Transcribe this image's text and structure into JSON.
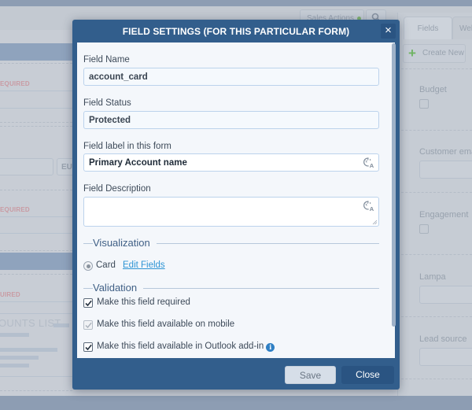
{
  "background": {
    "header": {
      "sales_actions_label": "Sales Actions",
      "search_icon": "search-icon"
    },
    "left_panel": {
      "required_labels": [
        "EQUIRED",
        "EQUIRED",
        "UIRED"
      ],
      "currency_label": "EU",
      "section_title": "OUNTS LIST"
    },
    "right_panel": {
      "tabs": [
        {
          "label": "Fields",
          "active": true
        },
        {
          "label": "Wel",
          "active": false
        }
      ],
      "create_new_label": "Create New",
      "fields": [
        {
          "label": "Budget",
          "type": "checkbox"
        },
        {
          "label": "Customer ema",
          "type": "input"
        },
        {
          "label": "Engagement",
          "type": "checkbox"
        },
        {
          "label": "Lampa",
          "type": "input"
        },
        {
          "label": "Lead source",
          "type": "input"
        }
      ]
    }
  },
  "modal": {
    "title": "FIELD SETTINGS (FOR THIS PARTICULAR FORM)",
    "close_glyph": "×",
    "fields": {
      "field_name": {
        "label": "Field Name",
        "value": "account_card"
      },
      "field_status": {
        "label": "Field Status",
        "value": "Protected"
      },
      "field_label": {
        "label": "Field label in this form",
        "value": "Primary Account name"
      },
      "field_description": {
        "label": "Field Description",
        "value": ""
      }
    },
    "visualization": {
      "title": "Visualization",
      "option_label": "Card",
      "option_selected": true,
      "edit_link": "Edit Fields"
    },
    "validation": {
      "title": "Validation",
      "options": [
        {
          "label": "Make this field required",
          "checked": true,
          "disabled": false
        },
        {
          "label": "Make this field available on mobile",
          "checked": true,
          "disabled": true
        },
        {
          "label": "Make this field available in Outlook add-in",
          "checked": true,
          "disabled": false,
          "info": true
        }
      ]
    },
    "footer": {
      "save_label": "Save",
      "close_label": "Close"
    }
  },
  "colors": {
    "modal_header": "#325e8c",
    "close_button": "#2a5482",
    "link": "#2d94d4",
    "info_icon": "#2f7fc4"
  }
}
